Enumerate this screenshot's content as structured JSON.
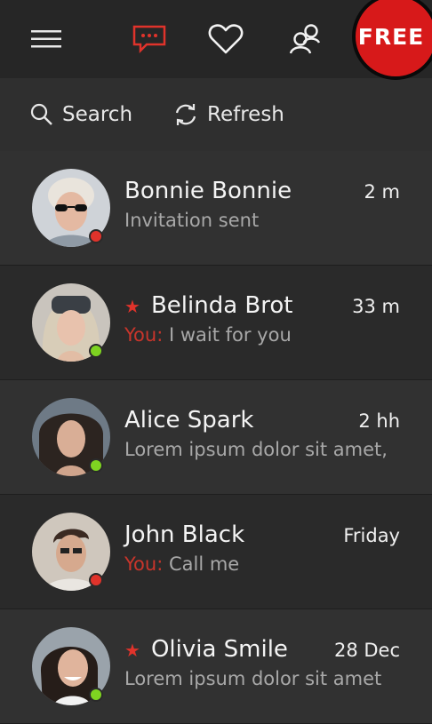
{
  "header": {
    "free_badge": "FREE",
    "icons": [
      "hamburger-menu-icon",
      "chat-icon",
      "heart-icon",
      "people-icon"
    ],
    "accent_color": "#e0332b"
  },
  "toolbar": {
    "search_label": "Search",
    "refresh_label": "Refresh"
  },
  "conversations": [
    {
      "name": "Bonnie Bonnie",
      "time": "2 m",
      "you_prefix": "",
      "message": "Invitation sent",
      "starred": false,
      "status": "offline",
      "status_color": "#e0332b"
    },
    {
      "name": "Belinda Brot",
      "time": "33 m",
      "you_prefix": "You:",
      "message": " I wait for you",
      "starred": true,
      "status": "online",
      "status_color": "#7ed321"
    },
    {
      "name": "Alice Spark",
      "time": "2 hh",
      "you_prefix": "",
      "message": "Lorem ipsum dolor sit amet,",
      "starred": false,
      "status": "online",
      "status_color": "#7ed321"
    },
    {
      "name": "John Black",
      "time": "Friday",
      "you_prefix": "You:",
      "message": " Call me",
      "starred": false,
      "status": "offline",
      "status_color": "#e0332b"
    },
    {
      "name": "Olivia Smile",
      "time": "28 Dec",
      "you_prefix": "",
      "message": "Lorem ipsum dolor sit amet",
      "starred": true,
      "status": "online",
      "status_color": "#7ed321"
    }
  ]
}
